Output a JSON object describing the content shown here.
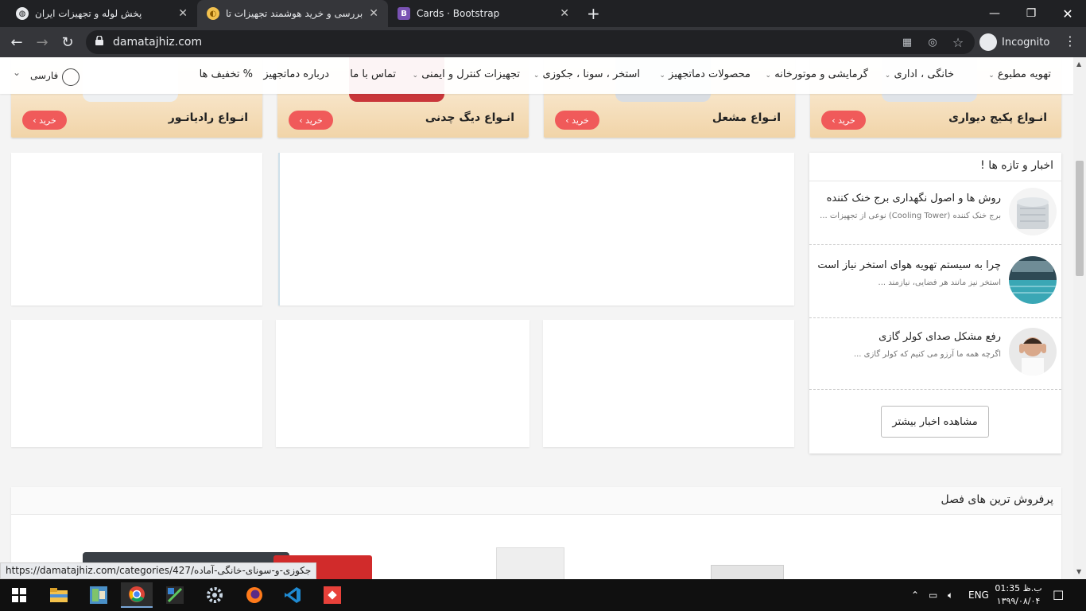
{
  "browser": {
    "tabs": [
      {
        "title": "پخش لوله و تجهیزات ایران",
        "active": false
      },
      {
        "title": "بررسی و خرید هوشمند تجهیزات تاسیسات",
        "active": true
      },
      {
        "title": "Cards · Bootstrap",
        "active": false
      }
    ],
    "url": "damatajhiz.com",
    "profile_label": "Incognito",
    "status_url": "https://damatajhiz.com/categories/427/جکوزی-و-سونای-خانگی-آماده"
  },
  "banners": [
    {
      "title": "انـواع پکیج دیواری",
      "button": "خرید ›"
    },
    {
      "title": "انـواع مشعل",
      "button": "خرید ›"
    },
    {
      "title": "انـواع دیگ چدنی",
      "button": "خرید ›"
    },
    {
      "title": "انـواع رادیاتـور",
      "button": "خرید ›"
    }
  ],
  "nav": {
    "items": [
      "تهویه مطبوع",
      "خانگی ، اداری",
      "گرمایشی و موتورخانه",
      "محصولات دماتجهیز",
      "استخر ، سونا ، جکوزی",
      "تجهیزات کنترل و ایمنی",
      "تماس با ما",
      "درباره دماتجهیز",
      "تخفیف ها"
    ],
    "discount_symbol": "%",
    "language": "فارسی"
  },
  "news": {
    "heading": "اخبار و تازه ها !",
    "items": [
      {
        "title": "روش ها و اصول نگهداری برج خنک کننده",
        "excerpt": "برج خنک کننده (Cooling Tower) نوعی از تجهیزات ..."
      },
      {
        "title": "چرا به سیستم تهویه هوای استخر نیاز است",
        "excerpt": "استخر نیز مانند هر فضایی، نیازمند ..."
      },
      {
        "title": "رفع مشکل صدای کولر گازی",
        "excerpt": "اگرچه همه ما آرزو می کنیم که کولر گازی ..."
      }
    ],
    "more_button": "مشاهده اخبار بیشتر"
  },
  "bestsellers": {
    "heading": "پرفروش ترین های فصل"
  },
  "taskbar": {
    "language": "ENG",
    "time": "01:35 ب.ظ",
    "date": "۱۳۹۹/۰۸/۰۴"
  },
  "colors": {
    "buy_button": "#f05a5a",
    "chrome_dark": "#202124",
    "chrome_bar": "#35363a"
  }
}
